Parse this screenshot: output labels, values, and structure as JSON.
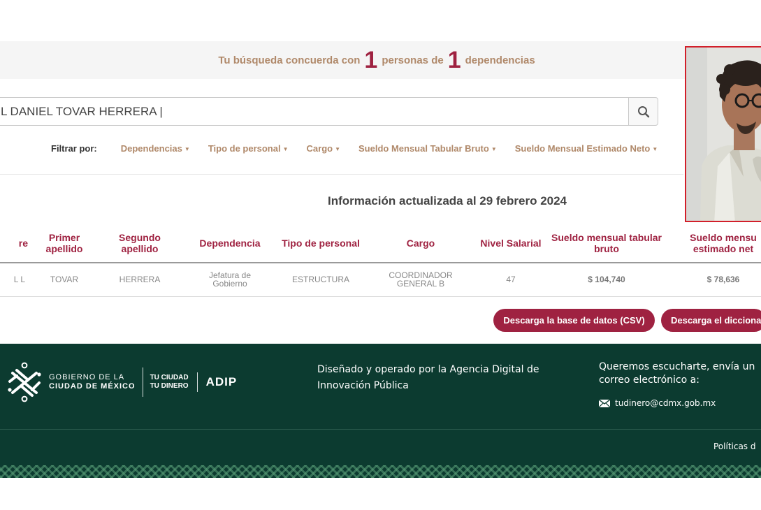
{
  "results": {
    "prefix": "Tu búsqueda concuerda con",
    "persons_count": "1",
    "middle": "personas de",
    "deps_count": "1",
    "suffix": "dependencias"
  },
  "search": {
    "value": "L DANIEL TOVAR HERRERA |"
  },
  "filters": {
    "label": "Filtrar por:",
    "items": [
      "Dependencias",
      "Tipo de personal",
      "Cargo",
      "Sueldo Mensual Tabular Bruto",
      "Sueldo Mensual Estimado Neto"
    ]
  },
  "updated": "Información actualizada al 29 febrero 2024",
  "table": {
    "headers": [
      "re",
      "Primer apellido",
      "Segundo apellido",
      "Dependencia",
      "Tipo de personal",
      "Cargo",
      "Nivel Salarial",
      "Sueldo mensual tabular bruto",
      "Sueldo mensu estimado net"
    ],
    "row": [
      "L L",
      "TOVAR",
      "HERRERA",
      "Jefatura de Gobierno",
      "ESTRUCTURA",
      "COORDINADOR GENERAL B",
      "47",
      "$ 104,740",
      "$ 78,636"
    ]
  },
  "buttons": {
    "csv": "Descarga la base de datos (CSV)",
    "dictionary": "Descarga el dicciona"
  },
  "footer": {
    "gov_line1": "GOBIERNO DE LA",
    "gov_line2": "CIUDAD DE MÉXICO",
    "tcd_line1": "TU CIUDAD",
    "tcd_line2": "TU DINERO",
    "adip": "ADIP",
    "designed": "Diseñado y operado por la Agencia Digital de Innovación Pública",
    "contact": "Queremos escucharte, envía un correo electrónico a:",
    "email": "tudinero@cdmx.gob.mx",
    "politicas": "Políticas d"
  },
  "colors": {
    "accent": "#9f2241",
    "gold": "#b0896a",
    "footer_bg": "#0c3b30",
    "photo_border": "#d21f2a"
  }
}
